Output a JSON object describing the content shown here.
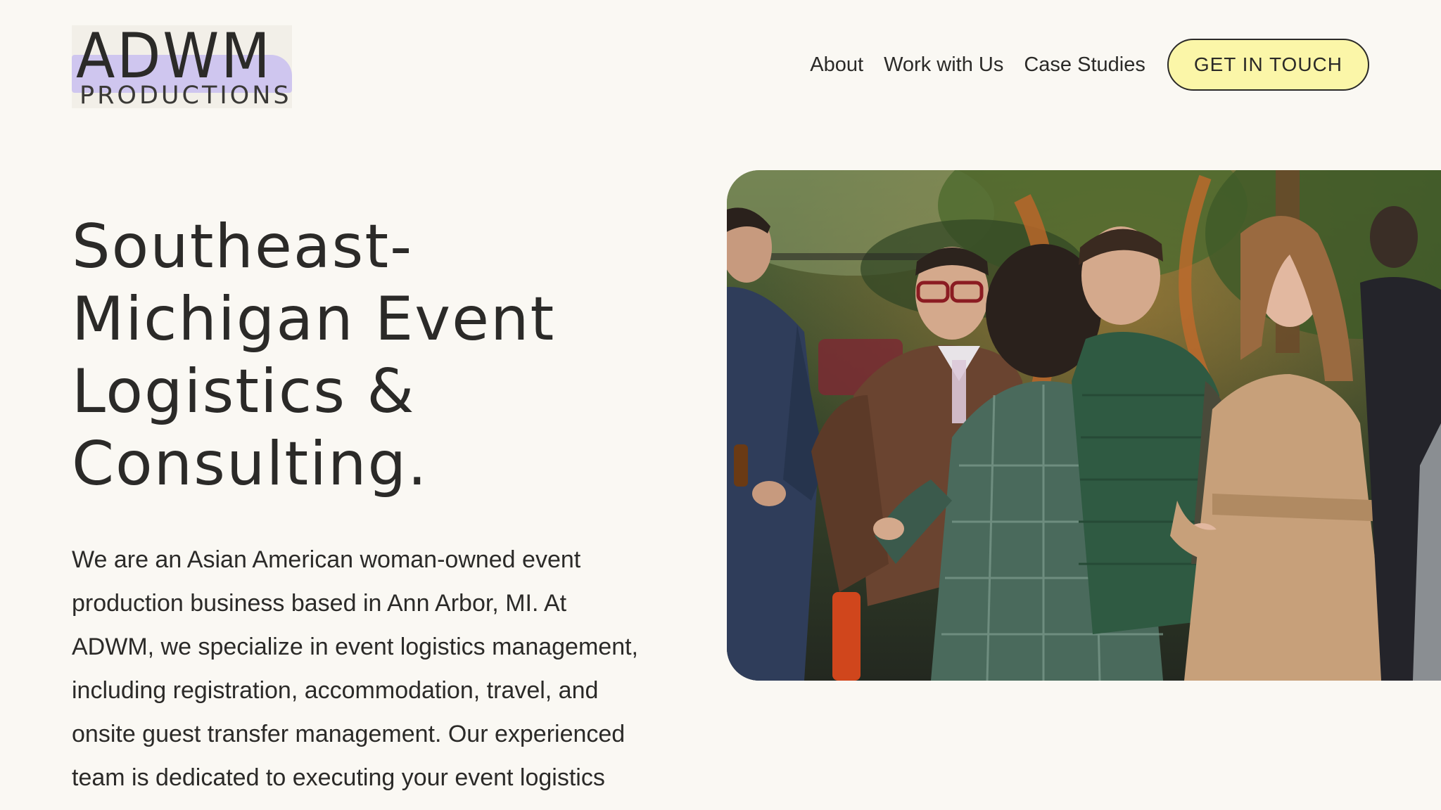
{
  "brand": {
    "name": "ADWM",
    "tagline": "PRODUCTIONS"
  },
  "nav": {
    "links": [
      "About",
      "Work with Us",
      "Case Studies"
    ],
    "cta_label": "GET IN TOUCH"
  },
  "hero": {
    "heading_lines": [
      "Southeast-",
      "Michigan Event",
      "Logistics &",
      "Consulting."
    ],
    "body_lines": [
      "We are an Asian American woman-owned event",
      "production business based in Ann Arbor, MI. At",
      "ADWM, we specialize in event logistics management,",
      "including registration, accommodation, travel, and",
      "onsite guest transfer management. Our experienced",
      "team is dedicated to executing your event logistics"
    ]
  },
  "colors": {
    "background": "#faf8f3",
    "text": "#2b2a28",
    "cta_background": "#fbf6a8",
    "logo_accent": "#cfc6ef"
  }
}
